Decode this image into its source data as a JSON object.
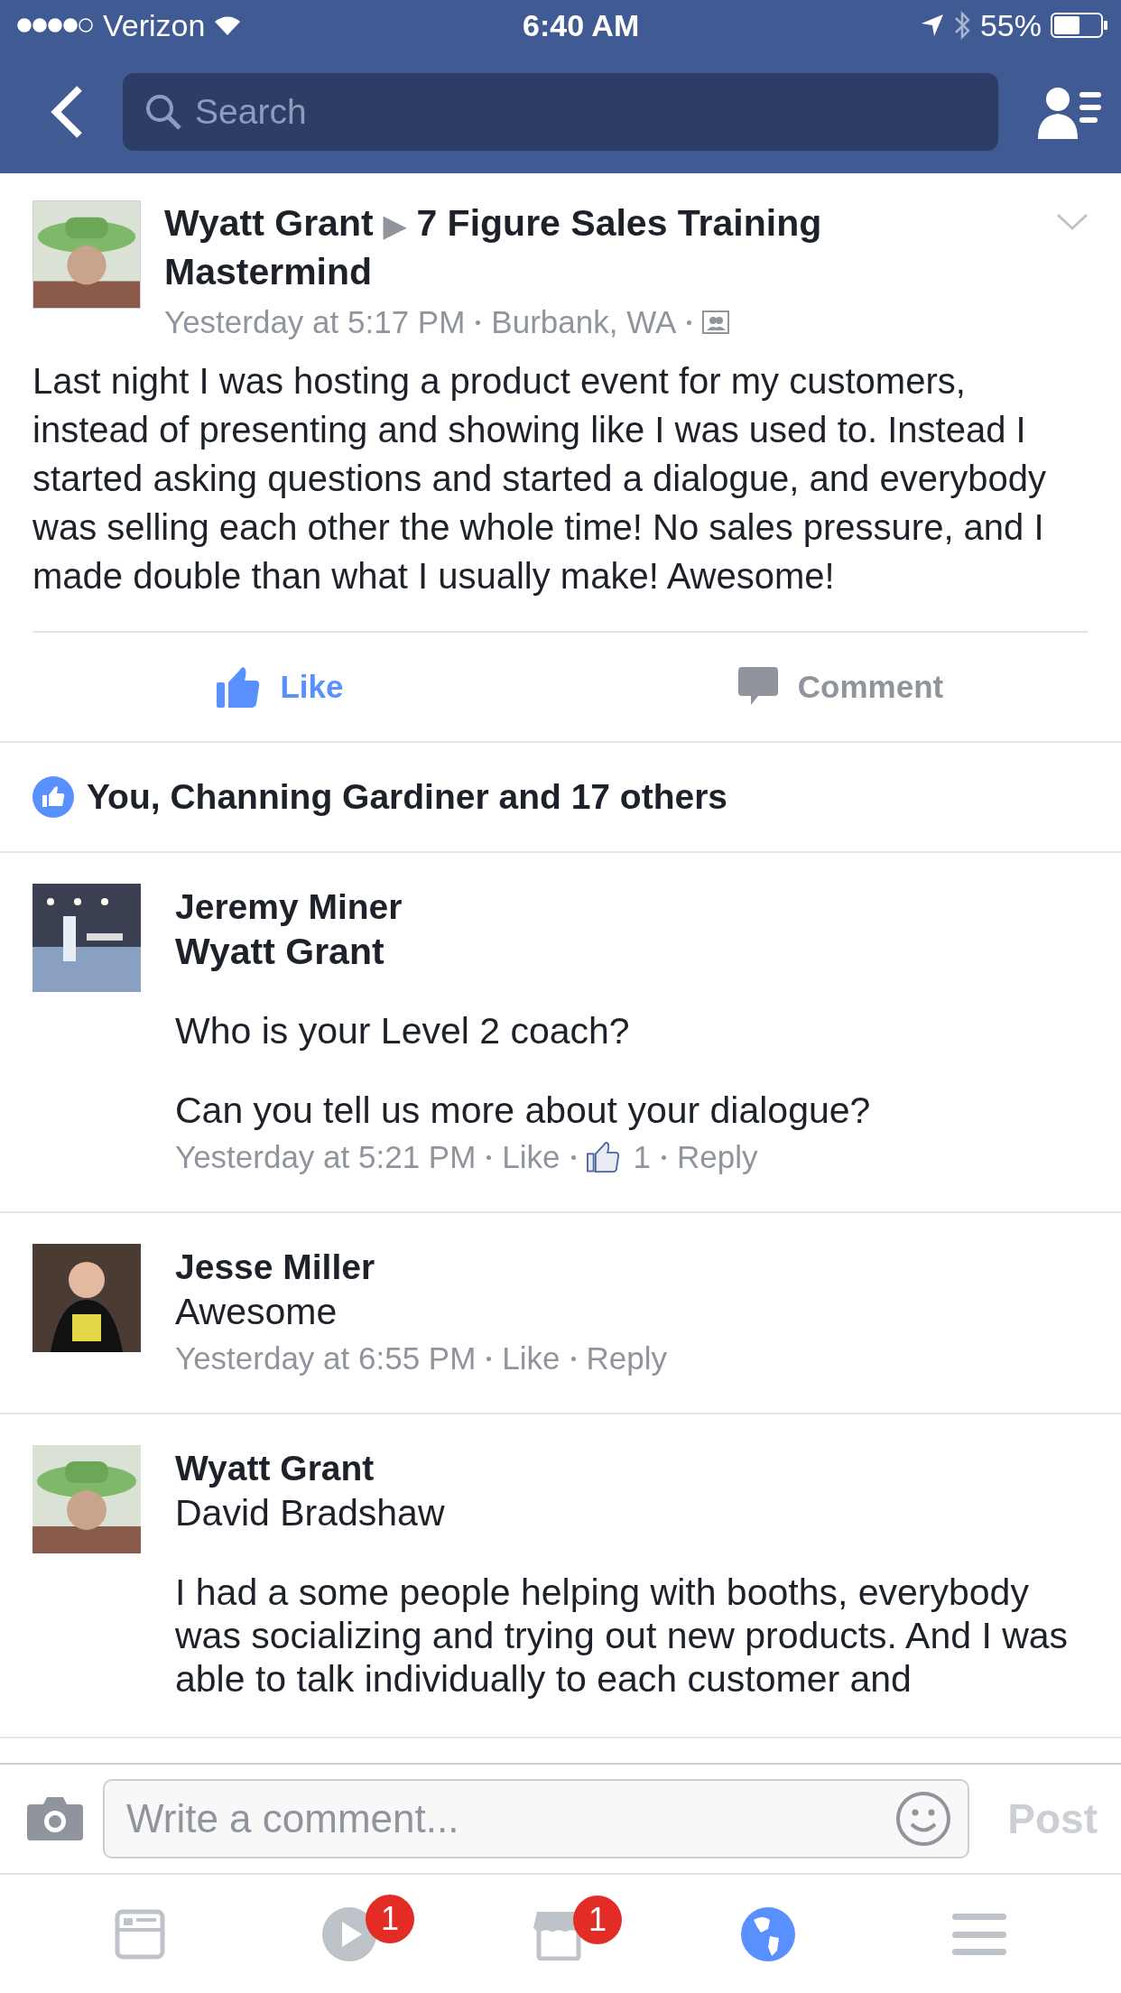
{
  "status_bar": {
    "carrier": "Verizon",
    "time": "6:40 AM",
    "battery": "55%"
  },
  "nav": {
    "search": {
      "placeholder": "Search"
    }
  },
  "post": {
    "author": "Wyatt Grant",
    "separator": "▶",
    "group": "7 Figure Sales Training Mastermind",
    "time": "Yesterday at 5:17 PM",
    "location": "Burbank, WA",
    "text": "Last night I was hosting a product event for my customers, instead of presenting and showing like I was used to. Instead I started asking questions and started a dialogue, and everybody was selling each other the whole time! No sales pressure, and I made double than what I usually make! Awesome!",
    "actions": [
      {
        "kind": "like",
        "label": "Like",
        "selected": true
      },
      {
        "kind": "comment",
        "label": "Comment",
        "selected": false
      }
    ],
    "likes": "You, Channing Gardiner and 17 others"
  },
  "comments": [
    {
      "name": "Jeremy Miner",
      "paragraphs": [
        {
          "text": "Wyatt Grant",
          "bold": true
        },
        {
          "text": "Who is your Level 2 coach?",
          "bold": false
        },
        {
          "text": "Can you tell us more about your dialogue?",
          "bold": false
        }
      ],
      "meta": [
        {
          "kind": "time",
          "text": "Yesterday at 5:21 PM"
        },
        {
          "kind": "action",
          "text": "Like"
        },
        {
          "kind": "likes",
          "text": "1"
        },
        {
          "kind": "action",
          "text": "Reply"
        }
      ]
    },
    {
      "name": "Jesse Miller",
      "paragraphs": [
        {
          "text": "Awesome",
          "bold": false
        }
      ],
      "meta": [
        {
          "kind": "time",
          "text": "Yesterday at 6:55 PM"
        },
        {
          "kind": "action",
          "text": "Like"
        },
        {
          "kind": "action",
          "text": "Reply"
        }
      ]
    },
    {
      "name": "Wyatt Grant",
      "paragraphs": [
        {
          "text": "David Bradshaw",
          "bold": false
        },
        {
          "text": "I had a some people helping with booths, everybody was socializing and trying out new products. And I was able to talk individually to each customer and",
          "bold": false
        }
      ]
    }
  ],
  "composer": {
    "placeholder": "Write a comment...",
    "post_button": "Post"
  },
  "tab_bar": [
    {
      "kind": "feed",
      "selected": false
    },
    {
      "kind": "video",
      "selected": false,
      "badge": "1"
    },
    {
      "kind": "marketplace",
      "selected": false,
      "badge": "1"
    },
    {
      "kind": "globe",
      "selected": true
    },
    {
      "kind": "menu",
      "selected": false
    }
  ]
}
